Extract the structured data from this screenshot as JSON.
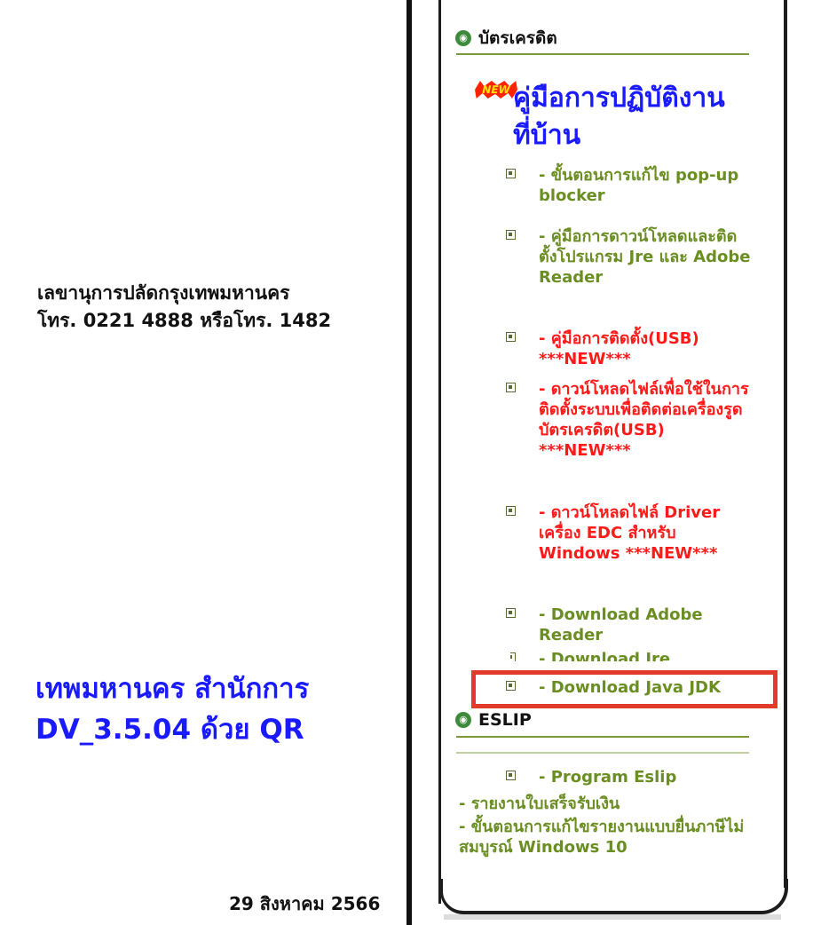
{
  "left_content": {
    "line1": "เลขานุการปลัดกรุงเทพมหานคร",
    "line2": "โทร. 0221 4888 หรือโทร. 1482",
    "headline1": "เทพมหานคร สำนักการ",
    "headline2": "DV_3.5.04 ด้วย QR",
    "date": "29 สิงหาคม 2566"
  },
  "sidebar": {
    "credit_section": {
      "icon": "circle-icon",
      "title": "บัตรเครดิต",
      "badge": "NEW",
      "manual_title": "คู่มือการปฏิบัติงานที่บ้าน",
      "items": [
        {
          "label": "- ขั้นตอนการแก้ไข pop-up blocker",
          "color": "#6b8e23"
        },
        {
          "label": "- คู่มือการดาวน์โหลดและติดตั้งโปรแกรม Jre และ Adobe Reader",
          "color": "#6b8e23"
        },
        {
          "label": "- คู่มือการติดตั้ง(USB) ***NEW***",
          "color": "#ff1a1a"
        },
        {
          "label": "- ดาวน์โหลดไฟล์เพื่อใช้ในการติดตั้งระบบเพื่อติดต่อเครื่องรูดบัตรเครดิต(USB) ***NEW***",
          "color": "#ff1a1a"
        },
        {
          "label": "- ดาวน์โหลดไฟล์ Driver เครื่อง EDC สำหรับ Windows ***NEW***",
          "color": "#ff1a1a"
        },
        {
          "label": "- Download Adobe Reader",
          "color": "#6b8e23"
        },
        {
          "label": "- Download Jre",
          "color": "#6b8e23"
        },
        {
          "label": "- Download Java JDK",
          "color": "#6b8e23"
        }
      ]
    },
    "eslip_section": {
      "icon": "circle-icon",
      "title": "ESLIP",
      "items": [
        "- Program Eslip",
        "- รายงานใบเสร็จรับเงิน",
        "- ขั้นตอนการแก้ไขรายงานแบบยื่นภาษีไม่สมบูรณ์ Windows 10"
      ]
    }
  }
}
